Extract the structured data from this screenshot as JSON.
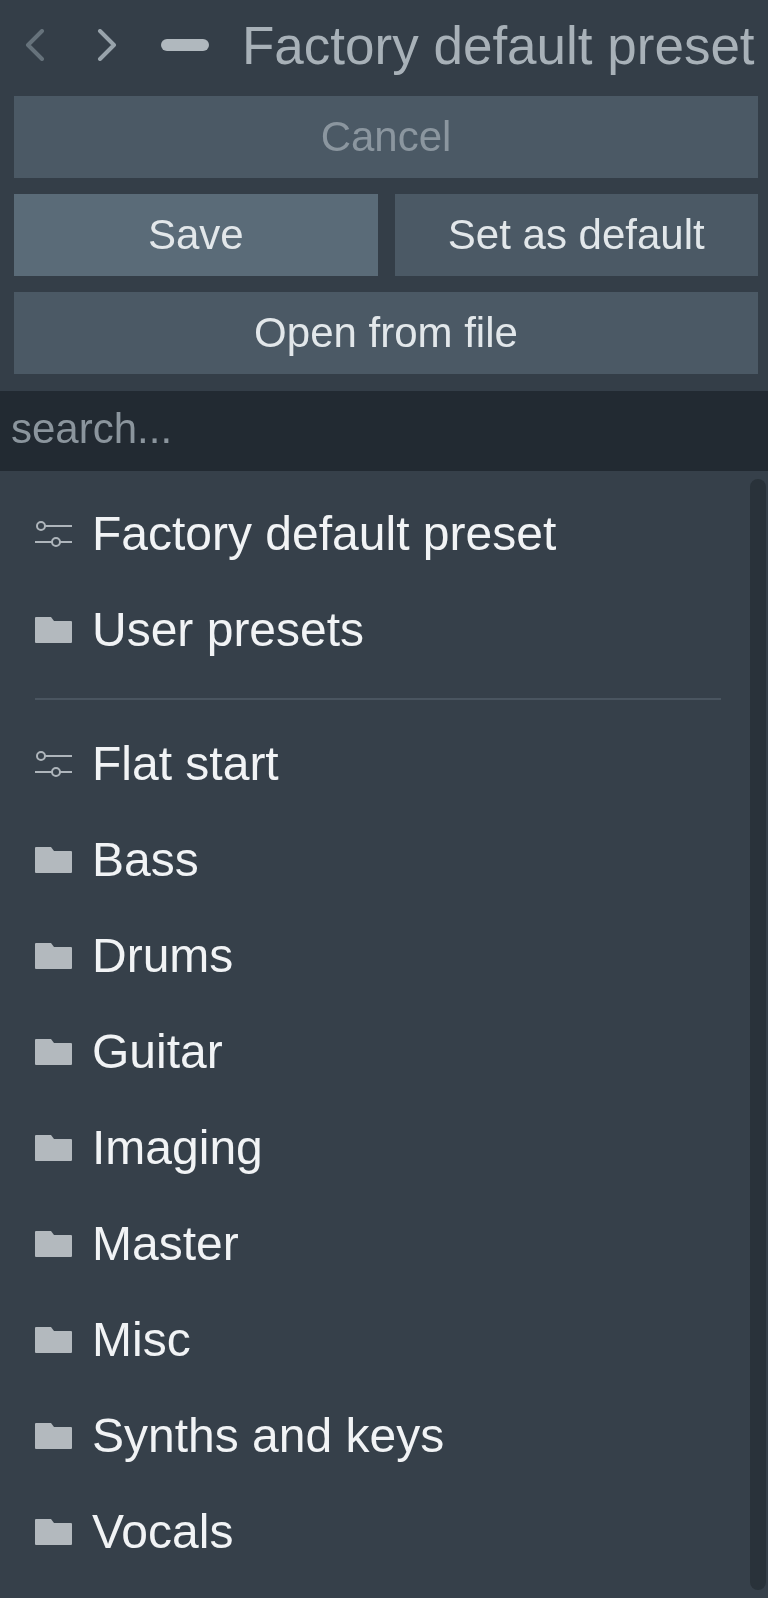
{
  "header": {
    "back": {
      "disabled": true
    },
    "forward": {
      "disabled": false
    },
    "title": "Factory default preset"
  },
  "button_rows": [
    {
      "buttons": [
        {
          "label": "Cancel",
          "disabled": true,
          "hovered": false
        }
      ]
    },
    {
      "buttons": [
        {
          "label": "Save",
          "disabled": false,
          "hovered": true
        },
        {
          "label": "Set as default",
          "disabled": false,
          "hovered": false
        }
      ]
    },
    {
      "buttons": [
        {
          "label": "Open from file",
          "disabled": false,
          "hovered": false
        }
      ]
    }
  ],
  "search": {
    "placeholder": "search..."
  },
  "sections": [
    {
      "items": [
        {
          "kind": "preset",
          "label": "Factory default preset"
        },
        {
          "kind": "folder",
          "label": "User presets"
        }
      ]
    },
    {
      "items": [
        {
          "kind": "preset",
          "label": "Flat start"
        },
        {
          "kind": "folder",
          "label": "Bass"
        },
        {
          "kind": "folder",
          "label": "Drums"
        },
        {
          "kind": "folder",
          "label": "Guitar"
        },
        {
          "kind": "folder",
          "label": "Imaging"
        },
        {
          "kind": "folder",
          "label": "Master"
        },
        {
          "kind": "folder",
          "label": "Misc"
        },
        {
          "kind": "folder",
          "label": "Synths and keys"
        },
        {
          "kind": "folder",
          "label": "Vocals"
        }
      ]
    }
  ]
}
